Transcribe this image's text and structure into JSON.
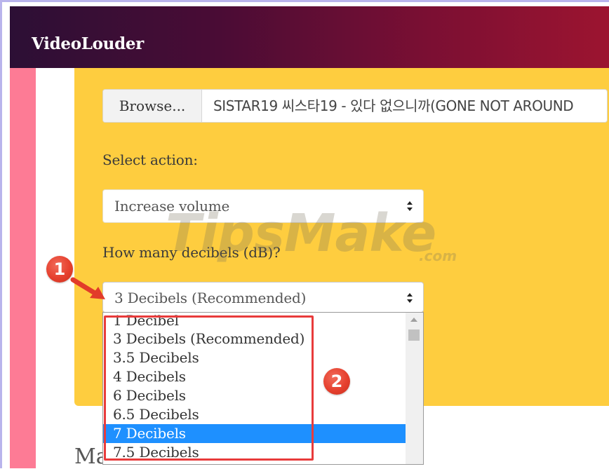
{
  "app": {
    "brand": "VideoLouder"
  },
  "upload": {
    "browse_label": "Browse...",
    "file_name": "SISTAR19 씨스타19 - 있다 없으니까(GONE NOT AROUND"
  },
  "action": {
    "label": "Select action:",
    "selected": "Increase volume"
  },
  "decibels": {
    "label": "How many decibels (dB)?",
    "selected": "3 Decibels (Recommended)",
    "options": [
      "1 Decibel",
      "3 Decibels (Recommended)",
      "3.5 Decibels",
      "4 Decibels",
      "6 Decibels",
      "6.5 Decibels",
      "7 Decibels",
      "7.5 Decibels"
    ],
    "highlighted_option": "7 Decibels"
  },
  "annotations": {
    "step1": "1",
    "step2": "2",
    "highlight_color": "#e83b3b"
  },
  "watermark": {
    "main": "TipsMake",
    "suffix": ".com"
  },
  "background_heading": "Main service features",
  "colors": {
    "header_start": "#2c0f35",
    "header_end": "#9c1430",
    "panel": "#fecd3f",
    "left_strip": "#fd7b95",
    "selection": "#1e90ff"
  }
}
